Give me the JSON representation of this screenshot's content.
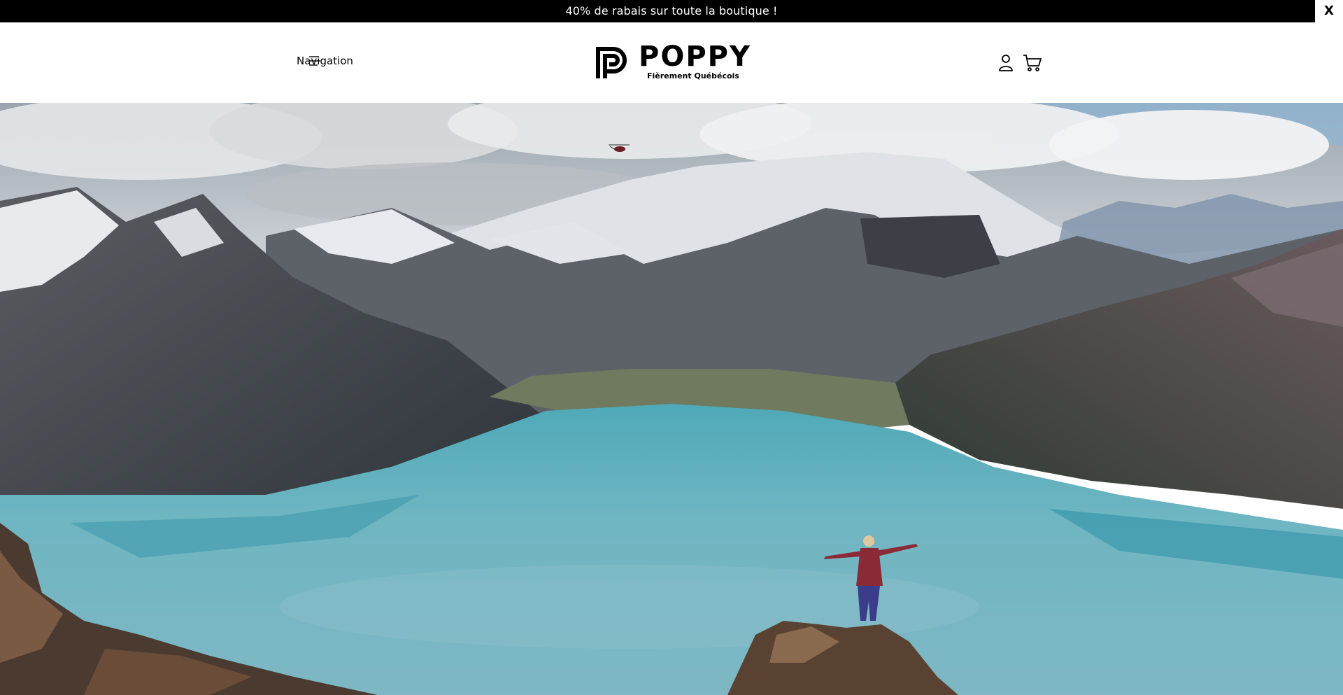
{
  "announcement": {
    "text": "40% de rabais sur toute la boutique !",
    "close_label": "X"
  },
  "header": {
    "nav_label": "Navigation",
    "logo_title": "POPPY",
    "logo_subtitle": "Fièrement Québécois",
    "icons": [
      "menu-icon",
      "account-icon",
      "cart-icon"
    ]
  },
  "hero": {
    "image_description_icon": "mountain-lake-image"
  },
  "colors": {
    "announcement_bg": "#000000",
    "announcement_text": "#ffffff",
    "header_bg": "#ffffff",
    "lake": "#5fb3c0"
  }
}
